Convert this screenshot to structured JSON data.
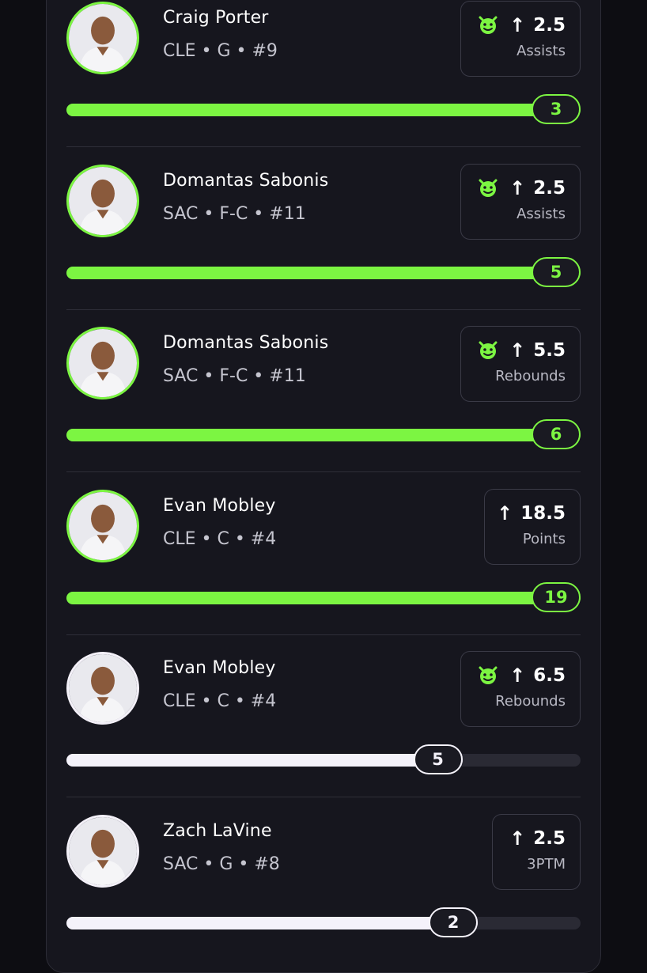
{
  "colors": {
    "accent": "#7cf542",
    "complete": "#f4f2fa",
    "background": "#0d0d12",
    "card": "#16161e"
  },
  "picks": [
    {
      "player": "Craig Porter",
      "team_line": "CLE • G • #9",
      "line": "2.5",
      "stat": "Assists",
      "result": "3",
      "demon": true,
      "hit": true,
      "progress": 1.0
    },
    {
      "player": "Domantas Sabonis",
      "team_line": "SAC • F-C • #11",
      "line": "2.5",
      "stat": "Assists",
      "result": "5",
      "demon": true,
      "hit": true,
      "progress": 1.0
    },
    {
      "player": "Domantas Sabonis",
      "team_line": "SAC • F-C • #11",
      "line": "5.5",
      "stat": "Rebounds",
      "result": "6",
      "demon": true,
      "hit": true,
      "progress": 1.0
    },
    {
      "player": "Evan Mobley",
      "team_line": "CLE • C • #4",
      "line": "18.5",
      "stat": "Points",
      "result": "19",
      "demon": false,
      "hit": true,
      "progress": 1.0
    },
    {
      "player": "Evan Mobley",
      "team_line": "CLE • C • #4",
      "line": "6.5",
      "stat": "Rebounds",
      "result": "5",
      "demon": true,
      "hit": false,
      "progress": 0.77
    },
    {
      "player": "Zach LaVine",
      "team_line": "SAC • G • #8",
      "line": "2.5",
      "stat": "3PTM",
      "result": "2",
      "demon": false,
      "hit": false,
      "progress": 0.8
    }
  ],
  "icons": {
    "direction": "arrow-up-icon",
    "demon": "demon-icon"
  },
  "arrow_glyph": "↑"
}
